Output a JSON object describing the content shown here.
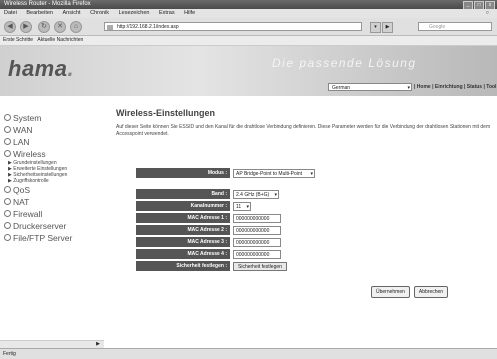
{
  "window": {
    "title": "Wireless Router - Mozilla Firefox",
    "buttons": [
      "_",
      "□",
      "x"
    ]
  },
  "menu": [
    "Datei",
    "Bearbeiten",
    "Ansicht",
    "Chronik",
    "Lesezeichen",
    "Extras",
    "Hilfe"
  ],
  "nav": {
    "back": "◀",
    "forward": "▶",
    "reload": "↻",
    "stop": "✕",
    "home": "⌂",
    "url": "http://192.168.2.1/index.asp",
    "search_placeholder": "Google"
  },
  "bookmarks": [
    "Erste Schritte",
    "Aktuelle Nachrichten"
  ],
  "header": {
    "logo": "hama",
    "logo_dot": ".",
    "slogan": "Die passende Lösung",
    "language": "German",
    "links": "| Home | Einrichtung | Status | Tool"
  },
  "sidebar": {
    "items": [
      "System",
      "WAN",
      "LAN",
      "Wireless"
    ],
    "wireless_sub": [
      "▶ Grundeinstellungen",
      "▶ Erweiterte Einstellungen",
      "▶ Sicherheitseinstellungen",
      "▶ Zugriffskontrolle"
    ],
    "items2": [
      "QoS",
      "NAT",
      "Firewall",
      "Druckerserver",
      "File/FTP Server"
    ]
  },
  "main": {
    "title": "Wireless-Einstellungen",
    "description": "Auf dieser Seite können Sie ESSID und den Kanal für die drahtlose Verbindung definieren. Diese Parameter werden für die Verbindung der drahtlosen Stationen mit dem Accesspoint verwendet."
  },
  "form": {
    "mode_label": "Modus :",
    "mode_value": "AP Bridge-Point to Multi-Point",
    "band_label": "Band :",
    "band_value": "2.4 GHz (B+G)",
    "channel_label": "Kanalnummer :",
    "channel_value": "11",
    "mac1_label": "MAC Adresse 1 :",
    "mac1_value": "000000000000",
    "mac2_label": "MAC Adresse 2 :",
    "mac2_value": "000000000000",
    "mac3_label": "MAC Adresse 3 :",
    "mac3_value": "000000000000",
    "mac4_label": "MAC Adresse 4 :",
    "mac4_value": "000000000000",
    "security_label": "Sicherheit festlegen :",
    "security_button": "Sicherheit festlegen"
  },
  "actions": {
    "apply": "Übernehmen",
    "cancel": "Abbrechen"
  },
  "status": "Fertig"
}
